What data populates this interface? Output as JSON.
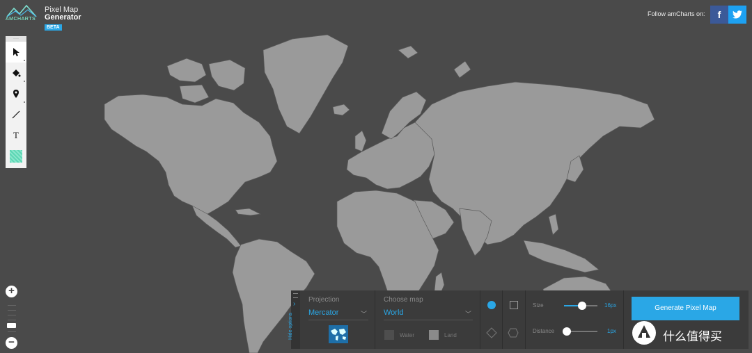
{
  "app": {
    "logo_text": "AMCHARTS",
    "title_line1": "Pixel Map",
    "title_line2": "Generator",
    "badge": "BETA"
  },
  "header": {
    "follow_text": "Follow amCharts on:",
    "social": [
      {
        "name": "facebook",
        "glyph": "f",
        "color": "#3b5998"
      },
      {
        "name": "twitter",
        "glyph": "t",
        "color": "#1da1f2"
      }
    ]
  },
  "tools": [
    {
      "name": "select",
      "icon": "cursor-icon"
    },
    {
      "name": "paint",
      "icon": "paint-bucket-icon"
    },
    {
      "name": "marker",
      "icon": "map-pin-icon"
    },
    {
      "name": "line",
      "icon": "line-icon"
    },
    {
      "name": "text",
      "icon": "text-icon",
      "glyph": "T"
    },
    {
      "name": "pattern",
      "icon": "pattern-swatch-icon",
      "color": "#5cd6b4"
    }
  ],
  "zoom": {
    "plus": "+",
    "minus": "−"
  },
  "panel": {
    "toggle_label": "Hide options",
    "projection": {
      "label": "Projection",
      "value": "Mercator"
    },
    "map": {
      "label": "Choose map",
      "value": "World"
    },
    "swatches": [
      {
        "label": "Water",
        "color": "#4a4a4a"
      },
      {
        "label": "Land",
        "color": "#9a9a9a"
      }
    ],
    "shapes": [
      "circle",
      "square",
      "diamond",
      "hexagon"
    ],
    "size": {
      "label": "Size",
      "value": "16px",
      "fraction": 0.55
    },
    "distance": {
      "label": "Distance",
      "value": "1px",
      "fraction": 0.04
    },
    "generate_label": "Generate Pixel Map"
  },
  "watermark": {
    "text": "什么值得买"
  },
  "colors": {
    "accent": "#2aa7e6",
    "map_bg": "#4a4a4a",
    "land": "#9a9a9a"
  }
}
